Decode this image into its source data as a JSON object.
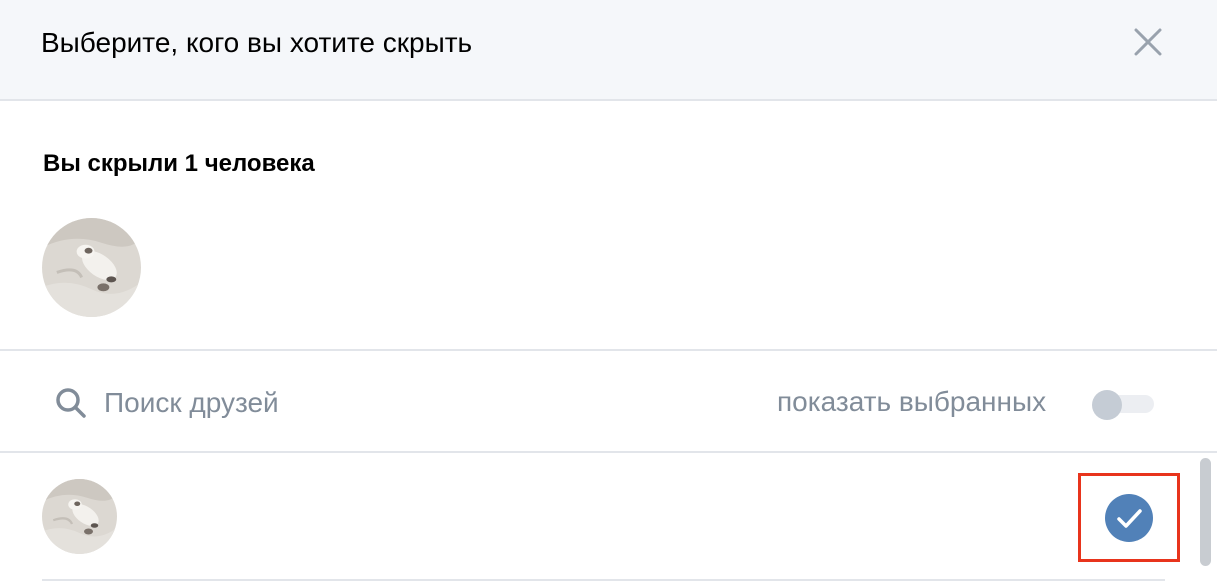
{
  "header": {
    "title": "Выберите, кого вы хотите скрыть",
    "close_icon": "close-icon"
  },
  "hidden_section": {
    "title": "Вы скрыли 1 человека",
    "avatars": [
      "avatar-photo"
    ]
  },
  "search": {
    "icon": "search-icon",
    "placeholder": "Поиск друзей",
    "value": ""
  },
  "filter": {
    "label": "показать выбранных",
    "toggle_on": false
  },
  "friends": [
    {
      "avatar": "avatar-photo",
      "name": "",
      "selected": true
    }
  ],
  "colors": {
    "header_bg": "#f5f7fa",
    "divider": "#e2e5ea",
    "muted_text": "#818c99",
    "accent": "#5181b8",
    "highlight": "#e8341c"
  }
}
